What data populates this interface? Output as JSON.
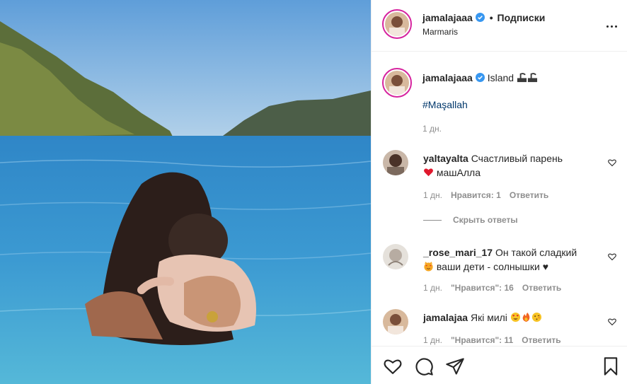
{
  "post": {
    "username": "jamalajaaa",
    "dot": "•",
    "follow_label": "Подписки",
    "location": "Marmaris"
  },
  "caption": {
    "username": "jamalajaaa",
    "text": "Island",
    "emoji": [
      "island-emoji",
      "island-emoji"
    ],
    "hashtag": "#Maşallah",
    "time": "1 дн."
  },
  "comments": [
    {
      "username": "yaltayalta",
      "text_1": "Счастливый парень",
      "text_2": "машАлла",
      "time": "1 дн.",
      "likes": "Нравится: 1",
      "reply": "Ответить"
    },
    {
      "username": "_rose_mari_17",
      "text_1": "Он такой сладкий",
      "text_2": "ваши дети - солнышки ♥",
      "time": "1 дн.",
      "likes": "\"Нравится\": 16",
      "reply": "Ответить"
    },
    {
      "username": "jamalajaa",
      "text_1": "Які милі",
      "time": "1 дн.",
      "likes": "\"Нравится\": 11",
      "reply": "Ответить"
    }
  ],
  "hide_replies": "Скрыть ответы",
  "icons": {
    "like": "heart-outline-icon",
    "comment": "comment-bubble-icon",
    "share": "paper-plane-icon",
    "save": "bookmark-icon",
    "more": "more-dots-icon",
    "verified": "verified-badge-icon"
  },
  "colors": {
    "verified": "#3897f0",
    "hashtag": "#00376b",
    "meta": "#8e8e8e",
    "story_ring": "#d6249f"
  }
}
